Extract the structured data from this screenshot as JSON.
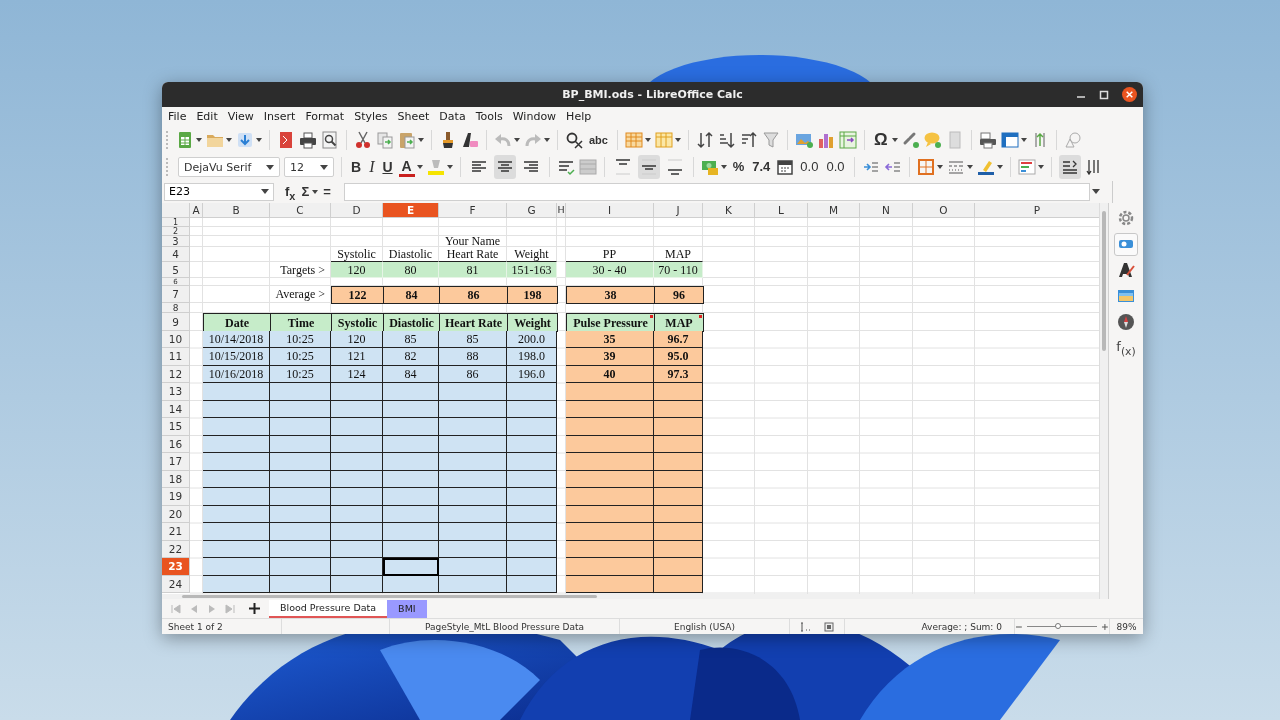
{
  "window": {
    "title": "BP_BMI.ods - LibreOffice Calc"
  },
  "menu": [
    "File",
    "Edit",
    "View",
    "Insert",
    "Format",
    "Styles",
    "Sheet",
    "Data",
    "Tools",
    "Window",
    "Help"
  ],
  "standard_toolbar": {
    "glyphs": [
      "abc",
      "Ω"
    ]
  },
  "formatting_toolbar": {
    "font_name": "DejaVu Serif",
    "font_size": "12",
    "glyphs": [
      "B",
      "I",
      "U",
      "A",
      "%",
      "7.4",
      "0.0",
      "0.0"
    ],
    "horizontal_align": [
      {
        "selected": false
      },
      {
        "selected": true
      },
      {
        "selected": false
      }
    ],
    "vertical_align": [
      {
        "selected": false
      },
      {
        "selected": true
      },
      {
        "selected": false
      }
    ],
    "wrap_text": {
      "selected": true
    }
  },
  "formula_bar": {
    "name_box": "E23",
    "glyphs": [
      "f$_{x}$",
      "Σ",
      "="
    ]
  },
  "sheet": {
    "column_headers": [
      {
        "label": "A",
        "selected": false
      },
      {
        "label": "B",
        "selected": false
      },
      {
        "label": "C",
        "selected": false
      },
      {
        "label": "D",
        "selected": false
      },
      {
        "label": "E",
        "selected": true
      },
      {
        "label": "F",
        "selected": false
      },
      {
        "label": "G",
        "selected": false
      },
      {
        "label": "H",
        "selected": false
      },
      {
        "label": "I",
        "selected": false
      },
      {
        "label": "J",
        "selected": false
      },
      {
        "label": "K",
        "selected": false
      },
      {
        "label": "L",
        "selected": false
      },
      {
        "label": "M",
        "selected": false
      },
      {
        "label": "N",
        "selected": false
      },
      {
        "label": "O",
        "selected": false
      },
      {
        "label": "P",
        "selected": false
      }
    ],
    "row_headers": [
      {
        "label": "1",
        "selected": false
      },
      {
        "label": "2",
        "selected": false
      },
      {
        "label": "3",
        "selected": false
      },
      {
        "label": "4",
        "selected": false
      },
      {
        "label": "5",
        "selected": false
      },
      {
        "label": "6",
        "selected": false
      },
      {
        "label": "7",
        "selected": false
      },
      {
        "label": "8",
        "selected": false
      },
      {
        "label": "9",
        "selected": false
      },
      {
        "label": "10",
        "selected": false
      },
      {
        "label": "11",
        "selected": false
      },
      {
        "label": "12",
        "selected": false
      },
      {
        "label": "13",
        "selected": false
      },
      {
        "label": "14",
        "selected": false
      },
      {
        "label": "15",
        "selected": false
      },
      {
        "label": "16",
        "selected": false
      },
      {
        "label": "17",
        "selected": false
      },
      {
        "label": "18",
        "selected": false
      },
      {
        "label": "19",
        "selected": false
      },
      {
        "label": "20",
        "selected": false
      },
      {
        "label": "21",
        "selected": false
      },
      {
        "label": "22",
        "selected": false
      },
      {
        "label": "23",
        "selected": true
      },
      {
        "label": "24",
        "selected": false
      }
    ],
    "title": "Your Name",
    "summary": {
      "headers": [
        "Systolic",
        "Diastolic",
        "Heart Rate",
        "Weight",
        "PP",
        "MAP"
      ],
      "targets_label": "Targets >",
      "targets": [
        "120",
        "80",
        "81",
        "151-163",
        "30 - 40",
        "70 - 110"
      ],
      "average_label": "Average >",
      "averages": [
        "122",
        "84",
        "86",
        "198",
        "38",
        "96"
      ]
    },
    "log": {
      "headers": [
        "Date",
        "Time",
        "Systolic",
        "Diastolic",
        "Heart Rate",
        "Weight"
      ],
      "result_headers": [
        {
          "label": "Pulse Pressure",
          "comment": true
        },
        {
          "label": "MAP",
          "comment": true
        }
      ],
      "rows": [
        {
          "values": [
            "10/14/2018",
            "10:25",
            "120",
            "85",
            "85",
            "200.0"
          ],
          "results": [
            "35",
            "96.7"
          ]
        },
        {
          "values": [
            "10/15/2018",
            "10:25",
            "121",
            "82",
            "88",
            "198.0"
          ],
          "results": [
            "39",
            "95.0"
          ]
        },
        {
          "values": [
            "10/16/2018",
            "10:25",
            "124",
            "84",
            "86",
            "196.0"
          ],
          "results": [
            "40",
            "97.3"
          ]
        }
      ]
    }
  },
  "sidebar": {
    "buttons": [
      {
        "selected": false
      },
      {
        "selected": true
      },
      {
        "selected": false
      },
      {
        "selected": false
      },
      {
        "selected": false
      }
    ],
    "glyph": "f$_{(x)}$"
  },
  "sheet_tabs": [
    {
      "label": "Blood Pressure Data",
      "selected": true
    },
    {
      "label": "BMI",
      "selected": false,
      "color": "#9999ff"
    }
  ],
  "status_bar": {
    "sheet": "Sheet 1 of 2",
    "page_style": "PageStyle_MtL Blood Pressure Data",
    "language": "English (USA)",
    "summary": "Average: ; Sum: 0",
    "zoom": {
      "level": 0.45,
      "reading": "89%"
    }
  }
}
